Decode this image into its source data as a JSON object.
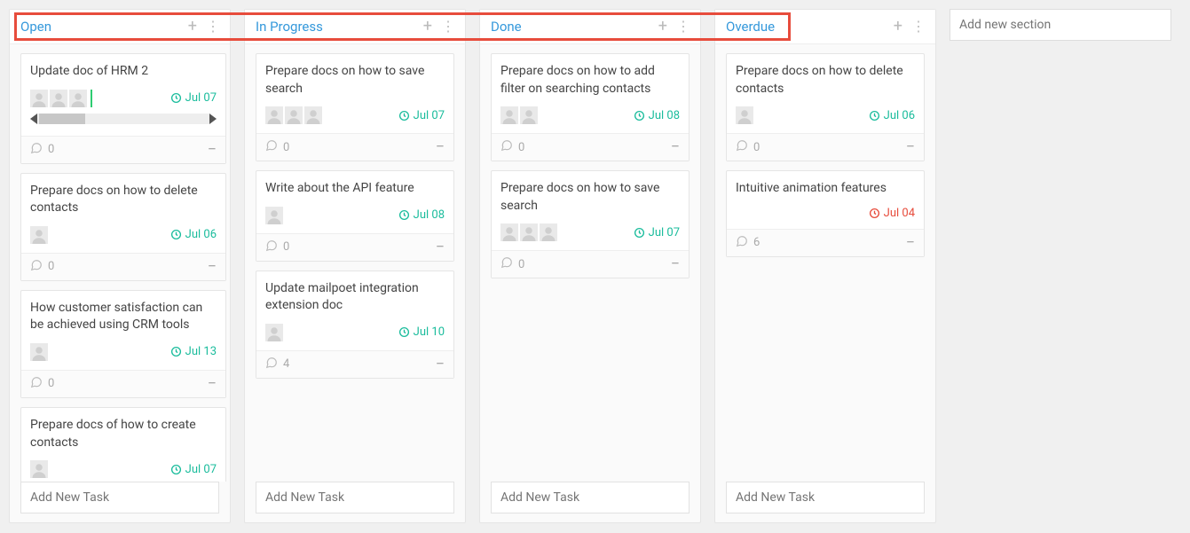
{
  "add_section_placeholder": "Add new section",
  "add_task_placeholder": "Add New Task",
  "columns": [
    {
      "title": "Open",
      "cards": [
        {
          "title": "Update doc of HRM 2",
          "avatars": 3,
          "vbar": true,
          "hslider": true,
          "due": "Jul 07",
          "due_color": "green",
          "comments": "0"
        },
        {
          "title": "Prepare docs on how to delete contacts",
          "avatars": 1,
          "due": "Jul 06",
          "due_color": "green",
          "comments": "0"
        },
        {
          "title": "How customer satisfaction can be achieved using CRM tools",
          "avatars": 1,
          "due": "Jul 13",
          "due_color": "green",
          "comments": "0"
        },
        {
          "title": "Prepare docs of how to create contacts",
          "avatars": 1,
          "due": "Jul 07",
          "due_color": "green",
          "no_footer": true
        }
      ]
    },
    {
      "title": "In Progress",
      "cards": [
        {
          "title": "Prepare docs on how to save search",
          "avatars": 3,
          "due": "Jul 07",
          "due_color": "green",
          "comments": "0"
        },
        {
          "title": "Write about the API feature",
          "avatars": 1,
          "due": "Jul 08",
          "due_color": "green",
          "comments": "0"
        },
        {
          "title": "Update mailpoet integration extension doc",
          "avatars": 1,
          "due": "Jul 10",
          "due_color": "green",
          "comments": "4"
        }
      ]
    },
    {
      "title": "Done",
      "cards": [
        {
          "title": "Prepare docs on how to add filter on searching contacts",
          "avatars": 2,
          "due": "Jul 08",
          "due_color": "green",
          "comments": "0"
        },
        {
          "title": "Prepare docs on how to save search",
          "avatars": 3,
          "due": "Jul 07",
          "due_color": "green",
          "comments": "0"
        }
      ]
    },
    {
      "title": "Overdue",
      "cards": [
        {
          "title": "Prepare docs on how to delete contacts",
          "avatars": 1,
          "due": "Jul 06",
          "due_color": "green",
          "comments": "0"
        },
        {
          "title": "Intuitive animation features",
          "avatars": 0,
          "due": "Jul 04",
          "due_color": "red",
          "comments": "6"
        }
      ]
    }
  ]
}
